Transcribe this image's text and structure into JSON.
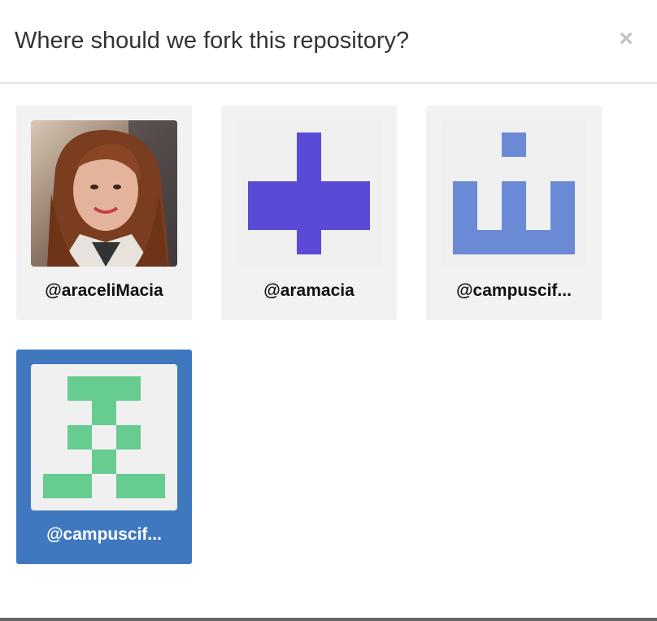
{
  "dialog": {
    "title": "Where should we fork this repository?",
    "close_symbol": "×"
  },
  "accounts": [
    {
      "handle": "@araceliMacia",
      "avatar": "photo-portrait",
      "selected": false
    },
    {
      "handle": "@aramacia",
      "avatar": "identicon-plus",
      "avatar_color": "#5a4bd6",
      "selected": false
    },
    {
      "handle": "@campuscif...",
      "avatar": "identicon-blue",
      "avatar_color": "#6b8ad6",
      "selected": false
    },
    {
      "handle": "@campuscif...",
      "avatar": "identicon-green",
      "avatar_color": "#66cc90",
      "selected": true
    }
  ],
  "colors": {
    "selected_card": "#4078c0",
    "card_background": "#f2f2f2"
  }
}
